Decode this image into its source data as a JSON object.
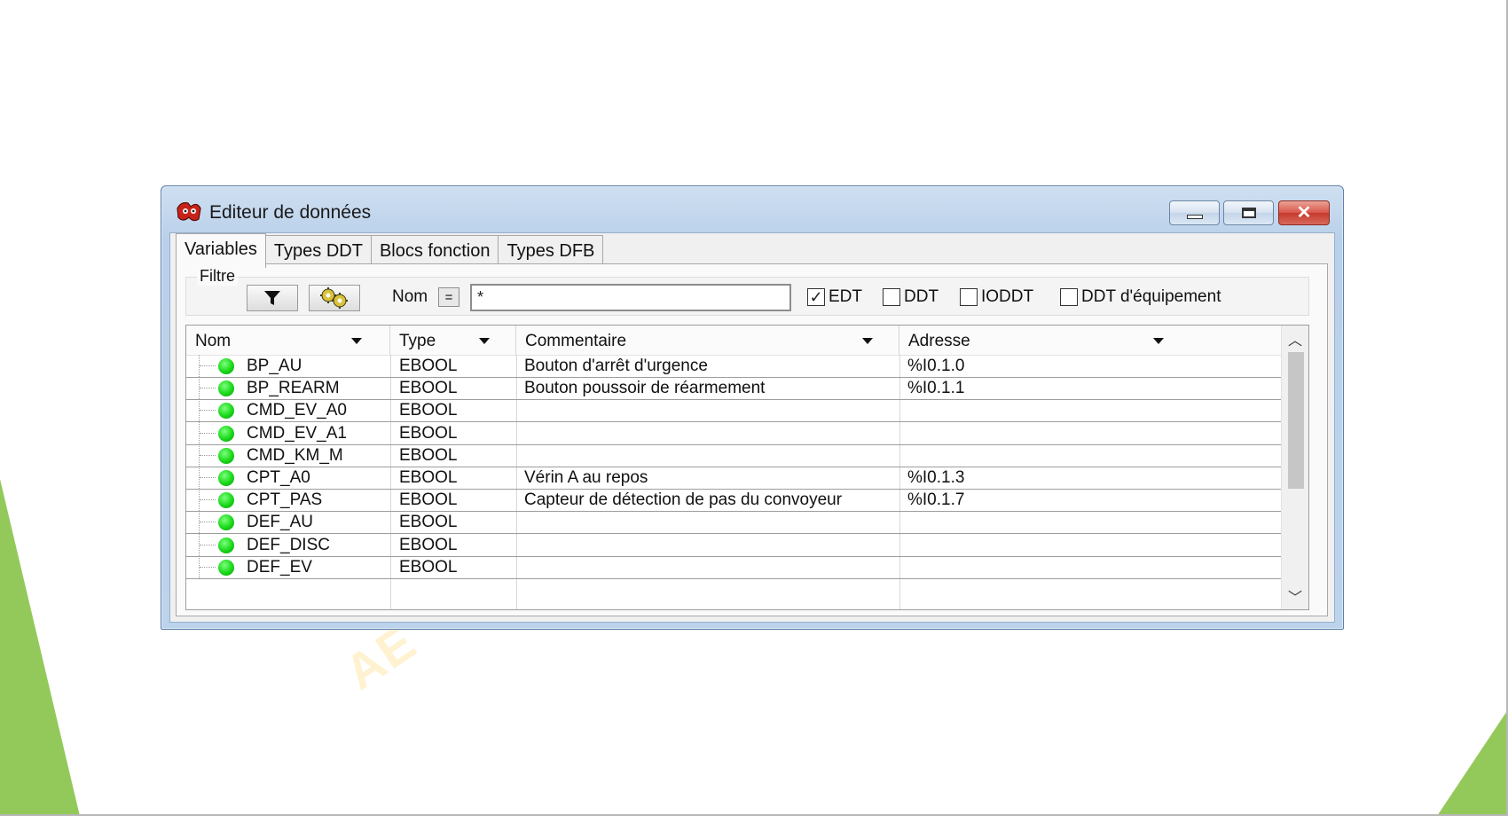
{
  "window": {
    "title": "Editeur de données",
    "accent_color": "#b9d0ea",
    "close_color": "#c43a2d"
  },
  "tabs": [
    {
      "label": "Variables",
      "active": true
    },
    {
      "label": "Types DDT",
      "active": false
    },
    {
      "label": "Blocs fonction",
      "active": false
    },
    {
      "label": "Types DFB",
      "active": false
    }
  ],
  "filter": {
    "legend": "Filtre",
    "name_label": "Nom",
    "operator": "=",
    "name_value": "*",
    "checkboxes": [
      {
        "label": "EDT",
        "checked": true
      },
      {
        "label": "DDT",
        "checked": false
      },
      {
        "label": "IODDT",
        "checked": false
      },
      {
        "label": "DDT d'équipement",
        "checked": false
      }
    ]
  },
  "table": {
    "columns": [
      "Nom",
      "Type",
      "Commentaire",
      "Adresse"
    ],
    "rows": [
      {
        "nom": "BP_AU",
        "type": "EBOOL",
        "commentaire": "Bouton d'arrêt d'urgence",
        "adresse": "%I0.1.0"
      },
      {
        "nom": "BP_REARM",
        "type": "EBOOL",
        "commentaire": "Bouton poussoir de réarmement",
        "adresse": "%I0.1.1"
      },
      {
        "nom": "CMD_EV_A0",
        "type": "EBOOL",
        "commentaire": "",
        "adresse": ""
      },
      {
        "nom": "CMD_EV_A1",
        "type": "EBOOL",
        "commentaire": "",
        "adresse": ""
      },
      {
        "nom": "CMD_KM_M",
        "type": "EBOOL",
        "commentaire": "",
        "adresse": ""
      },
      {
        "nom": "CPT_A0",
        "type": "EBOOL",
        "commentaire": "Vérin A au repos",
        "adresse": "%I0.1.3"
      },
      {
        "nom": "CPT_PAS",
        "type": "EBOOL",
        "commentaire": "Capteur de détection de pas du convoyeur",
        "adresse": "%I0.1.7"
      },
      {
        "nom": "DEF_AU",
        "type": "EBOOL",
        "commentaire": "",
        "adresse": ""
      },
      {
        "nom": "DEF_DISC",
        "type": "EBOOL",
        "commentaire": "",
        "adresse": ""
      },
      {
        "nom": "DEF_EV",
        "type": "EBOOL",
        "commentaire": "",
        "adresse": ""
      }
    ],
    "status_color": "#18d818"
  },
  "icons": {
    "app": "app-logo-icon",
    "filter": "funnel-icon",
    "gear": "gear-icon",
    "status": "green-dot-icon"
  }
}
